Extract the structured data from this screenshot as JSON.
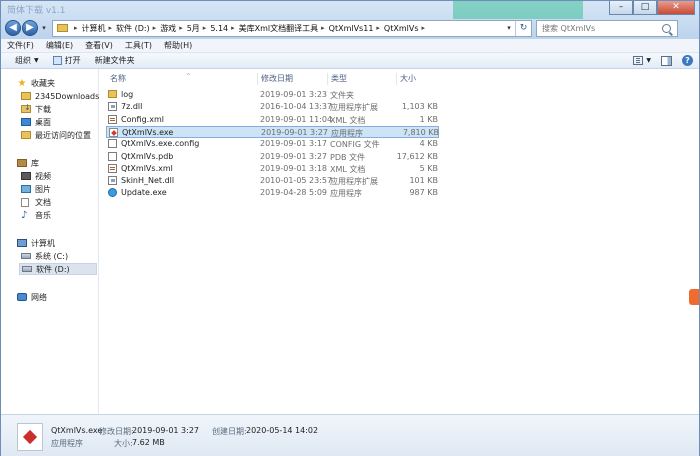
{
  "window": {
    "ghost_title": "简体下载 v1.1",
    "minimize": "–",
    "maximize": "□",
    "close": "✕"
  },
  "nav": {
    "back": "◀",
    "forward": "▶",
    "dropdown": "▾",
    "breadcrumbs": [
      "计算机",
      "软件 (D:)",
      "游戏",
      "5月",
      "5.14",
      "美库Xml文档翻译工具",
      "QtXmlVs11",
      "QtXmlVs"
    ],
    "separator": "▸",
    "refresh": "↻",
    "search_placeholder": "搜索 QtXmlVs"
  },
  "menu": [
    "文件(F)",
    "编辑(E)",
    "查看(V)",
    "工具(T)",
    "帮助(H)"
  ],
  "toolbar": {
    "organize": "组织",
    "open": "打开",
    "new_folder": "新建文件夹"
  },
  "sidebar": {
    "favorites": "收藏夹",
    "downloads_2345": "2345Downloads",
    "downloads": "下载",
    "desktop": "桌面",
    "recent": "最近访问的位置",
    "library": "库",
    "videos": "视频",
    "pictures": "图片",
    "documents": "文档",
    "music": "音乐",
    "computer": "计算机",
    "system_c": "系统 (C:)",
    "software_d": "软件 (D:)",
    "network": "网络"
  },
  "columns": {
    "name": "名称",
    "date": "修改日期",
    "type": "类型",
    "size": "大小"
  },
  "files": [
    {
      "name": "log",
      "date": "2019-09-01 3:23",
      "type": "文件夹",
      "size": "",
      "icon": "folder"
    },
    {
      "name": "7z.dll",
      "date": "2016-10-04 13:37",
      "type": "应用程序扩展",
      "size": "1,103 KB",
      "icon": "dll"
    },
    {
      "name": "Config.xml",
      "date": "2019-09-01 11:04",
      "type": "XML 文档",
      "size": "1 KB",
      "icon": "xml"
    },
    {
      "name": "QtXmlVs.exe",
      "date": "2019-09-01 3:27",
      "type": "应用程序",
      "size": "7,810 KB",
      "icon": "exe"
    },
    {
      "name": "QtXmlVs.exe.config",
      "date": "2019-09-01 3:17",
      "type": "CONFIG 文件",
      "size": "4 KB",
      "icon": "file"
    },
    {
      "name": "QtXmlVs.pdb",
      "date": "2019-09-01 3:27",
      "type": "PDB 文件",
      "size": "17,612 KB",
      "icon": "file"
    },
    {
      "name": "QtXmlVs.xml",
      "date": "2019-09-01 3:18",
      "type": "XML 文档",
      "size": "5 KB",
      "icon": "xml"
    },
    {
      "name": "SkinH_Net.dll",
      "date": "2010-01-05 23:57",
      "type": "应用程序扩展",
      "size": "101 KB",
      "icon": "dll"
    },
    {
      "name": "Update.exe",
      "date": "2019-04-28 5:09",
      "type": "应用程序",
      "size": "987 KB",
      "icon": "update"
    }
  ],
  "selected_file_index": 3,
  "details": {
    "name": "QtXmlVs.exe",
    "kind": "应用程序",
    "modified_label": "修改日期:",
    "modified_value": "2019-09-01 3:27",
    "created_label": "创建日期:",
    "created_value": "2020-05-14 14:02",
    "size_label": "大小:",
    "size_value": "7.62 MB"
  }
}
